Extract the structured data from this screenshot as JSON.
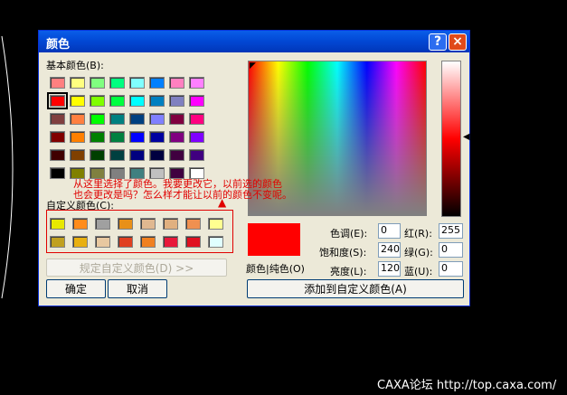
{
  "dialog": {
    "title": "颜色",
    "help_label": "?",
    "close_label": "×",
    "basic_colors_label": "基本颜色(B):",
    "custom_colors_label": "自定义颜色(C):",
    "define_custom_label": "规定自定义颜色(D) >>",
    "ok_label": "确定",
    "cancel_label": "取消",
    "add_custom_label": "添加到自定义颜色(A)",
    "color_solid_label": "颜色|纯色(O)",
    "hue_label": "色调(E):",
    "hue_value": "0",
    "sat_label": "饱和度(S):",
    "sat_value": "240",
    "lum_label": "亮度(L):",
    "lum_value": "120",
    "red_label": "红(R):",
    "red_value": "255",
    "green_label": "绿(G):",
    "green_value": "0",
    "blue_label": "蓝(U):",
    "blue_value": "0",
    "preview_color": "#ff0000"
  },
  "basic_colors": [
    [
      "#ff8080",
      "#ffff80",
      "#80ff80",
      "#00ff80",
      "#80ffff",
      "#0080ff",
      "#ff80c0",
      "#ff80ff"
    ],
    [
      "#ff0000",
      "#ffff00",
      "#80ff00",
      "#00ff40",
      "#00ffff",
      "#0080c0",
      "#8080c0",
      "#ff00ff"
    ],
    [
      "#804040",
      "#ff8040",
      "#00ff00",
      "#008080",
      "#004080",
      "#8080ff",
      "#800040",
      "#ff0080"
    ],
    [
      "#800000",
      "#ff8000",
      "#008000",
      "#008040",
      "#0000ff",
      "#0000a0",
      "#800080",
      "#8000ff"
    ],
    [
      "#400000",
      "#804000",
      "#004000",
      "#004040",
      "#000080",
      "#000040",
      "#400040",
      "#400080"
    ],
    [
      "#000000",
      "#808000",
      "#808040",
      "#808080",
      "#408080",
      "#c0c0c0",
      "#400040",
      "#ffffff"
    ]
  ],
  "custom_colors": [
    [
      "#e8e800",
      "#ff8c1a",
      "#a0a0a0",
      "#e89018",
      "#e0b890",
      "#e0b080",
      "#f09050",
      "#ffff90"
    ],
    [
      "#c0a020",
      "#e8b010",
      "#e8c8a0",
      "#e04020",
      "#f08020",
      "#e8183a",
      "#e01020",
      "#e0ffff"
    ]
  ],
  "annotation": {
    "line1": "从这里选择了颜色。我要更改它，以前选的颜色",
    "line2": "也会更改是吗？怎么样才能让以前的颜色不变呢。"
  },
  "footer_text": "CAXA论坛 http://top.caxa.com/"
}
